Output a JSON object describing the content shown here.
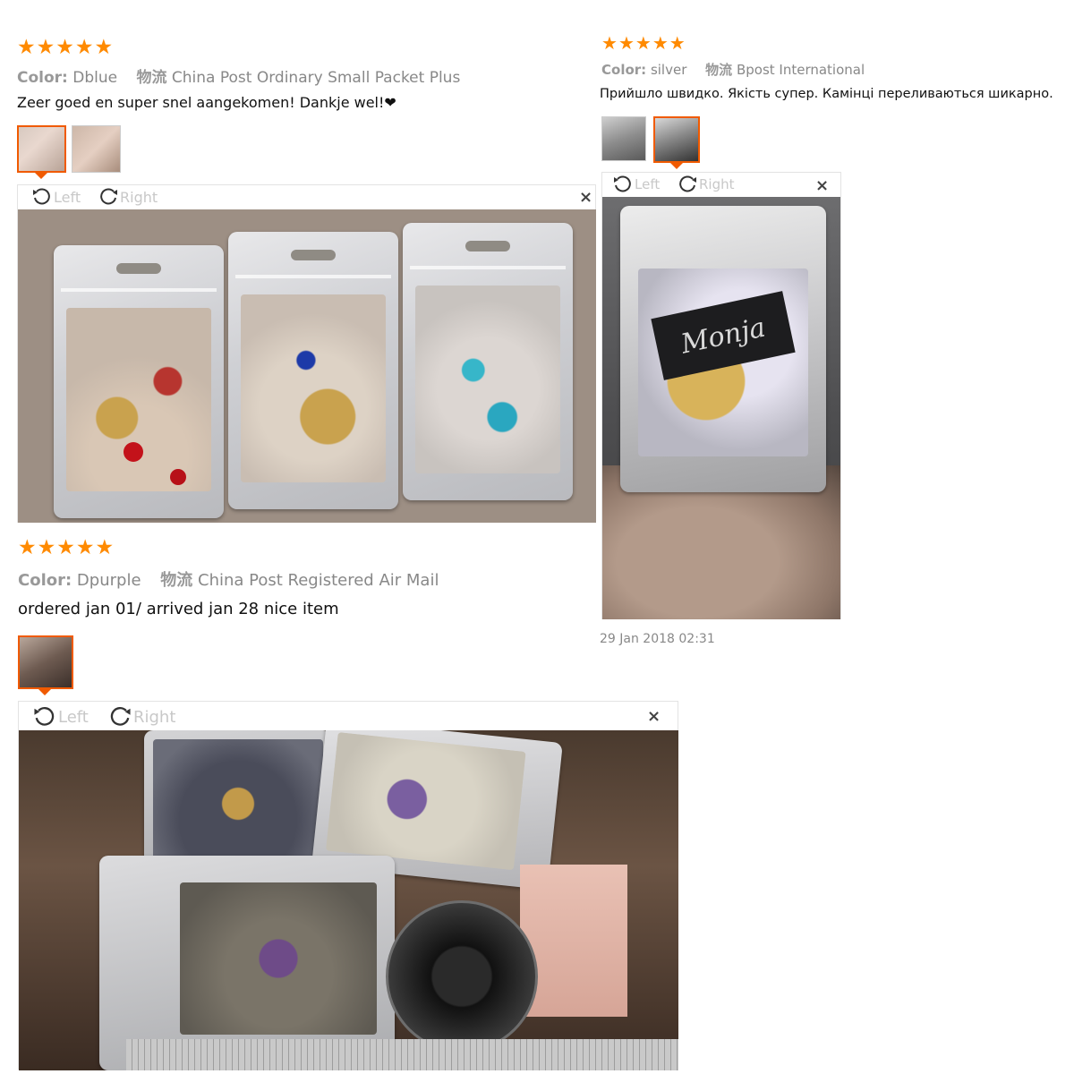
{
  "colors": {
    "star": "#ff8a00",
    "accent_border": "#f05a00",
    "muted_text": "#999999"
  },
  "reviews": [
    {
      "stars": 5,
      "color_label": "Color:",
      "color_value": "Dblue",
      "shipping_icon": "物流",
      "shipping": "China Post Ordinary Small Packet Plus",
      "comment": "Zeer goed en super snel aangekomen! Dankje wel!❤",
      "toolbar": {
        "left": "Left",
        "right": "Right",
        "close": "×"
      },
      "photo_desc_icon": "three-bags-photo"
    },
    {
      "stars": 5,
      "color_label": "Color:",
      "color_value": "silver",
      "shipping_icon": "物流",
      "shipping": "Bpost International",
      "comment": "Прийшло швидко. Якість супер. Камінці переливаються шикарно.",
      "toolbar": {
        "left": "Left",
        "right": "Right",
        "close": "×"
      },
      "photo_label": "Monja",
      "date": "29 Jan 2018 02:31"
    },
    {
      "stars": 5,
      "color_label": "Color:",
      "color_value": "Dpurple",
      "shipping_icon": "物流",
      "shipping": "China Post Registered Air Mail",
      "comment": "ordered jan 01/ arrived jan 28 nice item",
      "toolbar": {
        "left": "Left",
        "right": "Right",
        "close": "×"
      }
    }
  ]
}
